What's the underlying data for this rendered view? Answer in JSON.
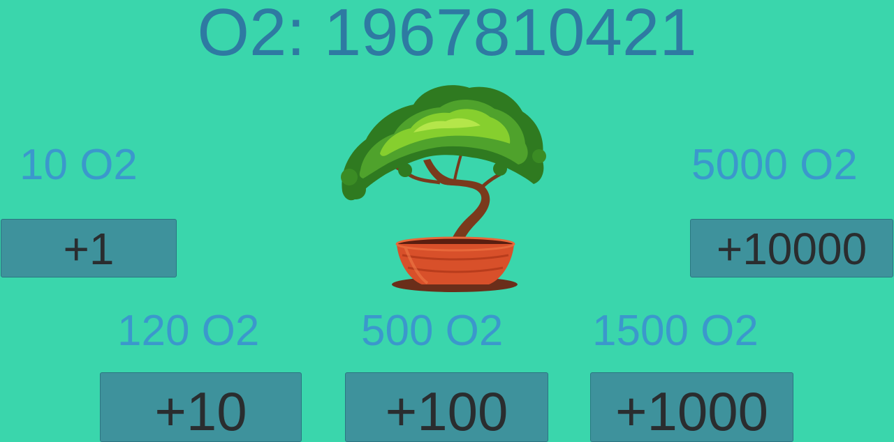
{
  "counter": {
    "text": "O2: 1967810421"
  },
  "upgrades": [
    {
      "cost": "10 O2",
      "button": "+1"
    },
    {
      "cost": "5000 O2",
      "button": "+10000"
    },
    {
      "cost": "120 O2",
      "button": "+10"
    },
    {
      "cost": "500 O2",
      "button": "+100"
    },
    {
      "cost": "1500 O2",
      "button": "+1000"
    }
  ],
  "tree": {
    "icon": "bonsai-tree-icon"
  },
  "colors": {
    "background": "#3ad6ac",
    "counter_text": "#2e7aa2",
    "cost_text": "#3b98cc",
    "button_fill": "#3e929c",
    "button_text": "#2a2d2f"
  }
}
